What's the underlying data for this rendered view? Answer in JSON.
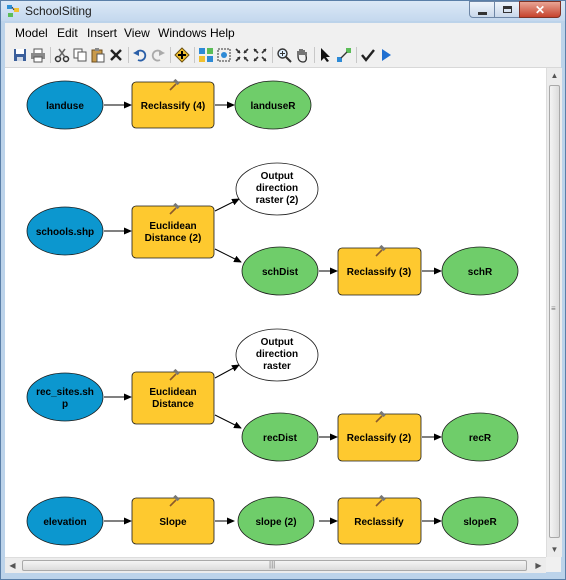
{
  "window": {
    "title": "SchoolSiting"
  },
  "menu": [
    "Model",
    "Edit",
    "Insert",
    "View",
    "Windows",
    "Help"
  ],
  "toolbar": [
    "save",
    "print",
    "cut",
    "copy",
    "paste",
    "delete",
    "undo",
    "redo",
    "add-data",
    "auto-layout",
    "full-extent",
    "fixed-zoom-in",
    "fixed-zoom-out",
    "zoom-in",
    "pan",
    "select",
    "connect",
    "validate",
    "run"
  ],
  "colors": {
    "input_data": "#0c97cf",
    "derived_data": "#6fcd6a",
    "tool": "#fec92f",
    "output_raster": "#ffffff"
  },
  "model": {
    "row1": {
      "input": "landuse",
      "tool": "Reclassify (4)",
      "output": "landuseR"
    },
    "row2": {
      "input": "schools.shp",
      "tool": [
        "Euclidean",
        "Distance (2)"
      ],
      "direction": [
        "Output",
        "direction",
        "raster (2)"
      ],
      "derived": "schDist",
      "tool2": "Reclassify (3)",
      "output": "schR"
    },
    "row3": {
      "input": [
        "rec_sites.sh",
        "p"
      ],
      "tool": [
        "Euclidean",
        "Distance"
      ],
      "direction": [
        "Output",
        "direction",
        "raster"
      ],
      "derived": "recDist",
      "tool2": "Reclassify (2)",
      "output": "recR"
    },
    "row4": {
      "input": "elevation",
      "tool": "Slope",
      "derived": "slope (2)",
      "tool2": "Reclassify",
      "output": "slopeR"
    }
  }
}
